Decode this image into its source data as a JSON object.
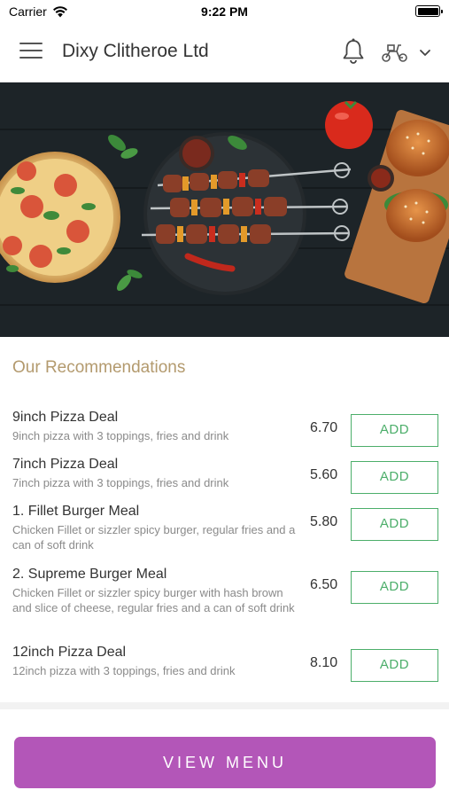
{
  "status_bar": {
    "carrier": "Carrier",
    "time": "9:22 PM"
  },
  "header": {
    "title": "Dixy Clitheroe Ltd"
  },
  "icons": {
    "menu": "hamburger-icon",
    "notifications": "bell-icon",
    "delivery": "scooter-icon",
    "dropdown": "chevron-down-icon"
  },
  "colors": {
    "accent_green": "#4cae6a",
    "button_purple": "#b356b8",
    "section_title": "#b39a6e"
  },
  "recommendations": {
    "title": "Our Recommendations",
    "items": [
      {
        "name": "9inch Pizza Deal",
        "description": "9inch pizza with 3 toppings, fries and drink",
        "price": "6.70",
        "button": "ADD"
      },
      {
        "name": "7inch Pizza Deal",
        "description": "7inch pizza with 3 toppings, fries and drink",
        "price": "5.60",
        "button": "ADD"
      },
      {
        "name": "1. Fillet Burger Meal",
        "description": "Chicken Fillet or sizzler spicy burger, regular fries and a can of soft drink",
        "price": "5.80",
        "button": "ADD"
      },
      {
        "name": "2. Supreme Burger Meal",
        "description": "Chicken Fillet or sizzler spicy burger with hash brown and slice of cheese, regular fries and a can of soft drink",
        "price": "6.50",
        "button": "ADD"
      },
      {
        "name": "12inch Pizza Deal",
        "description": "12inch pizza with 3 toppings, fries and drink",
        "price": "8.10",
        "button": "ADD"
      }
    ]
  },
  "footer": {
    "view_menu_label": "VIEW MENU"
  }
}
